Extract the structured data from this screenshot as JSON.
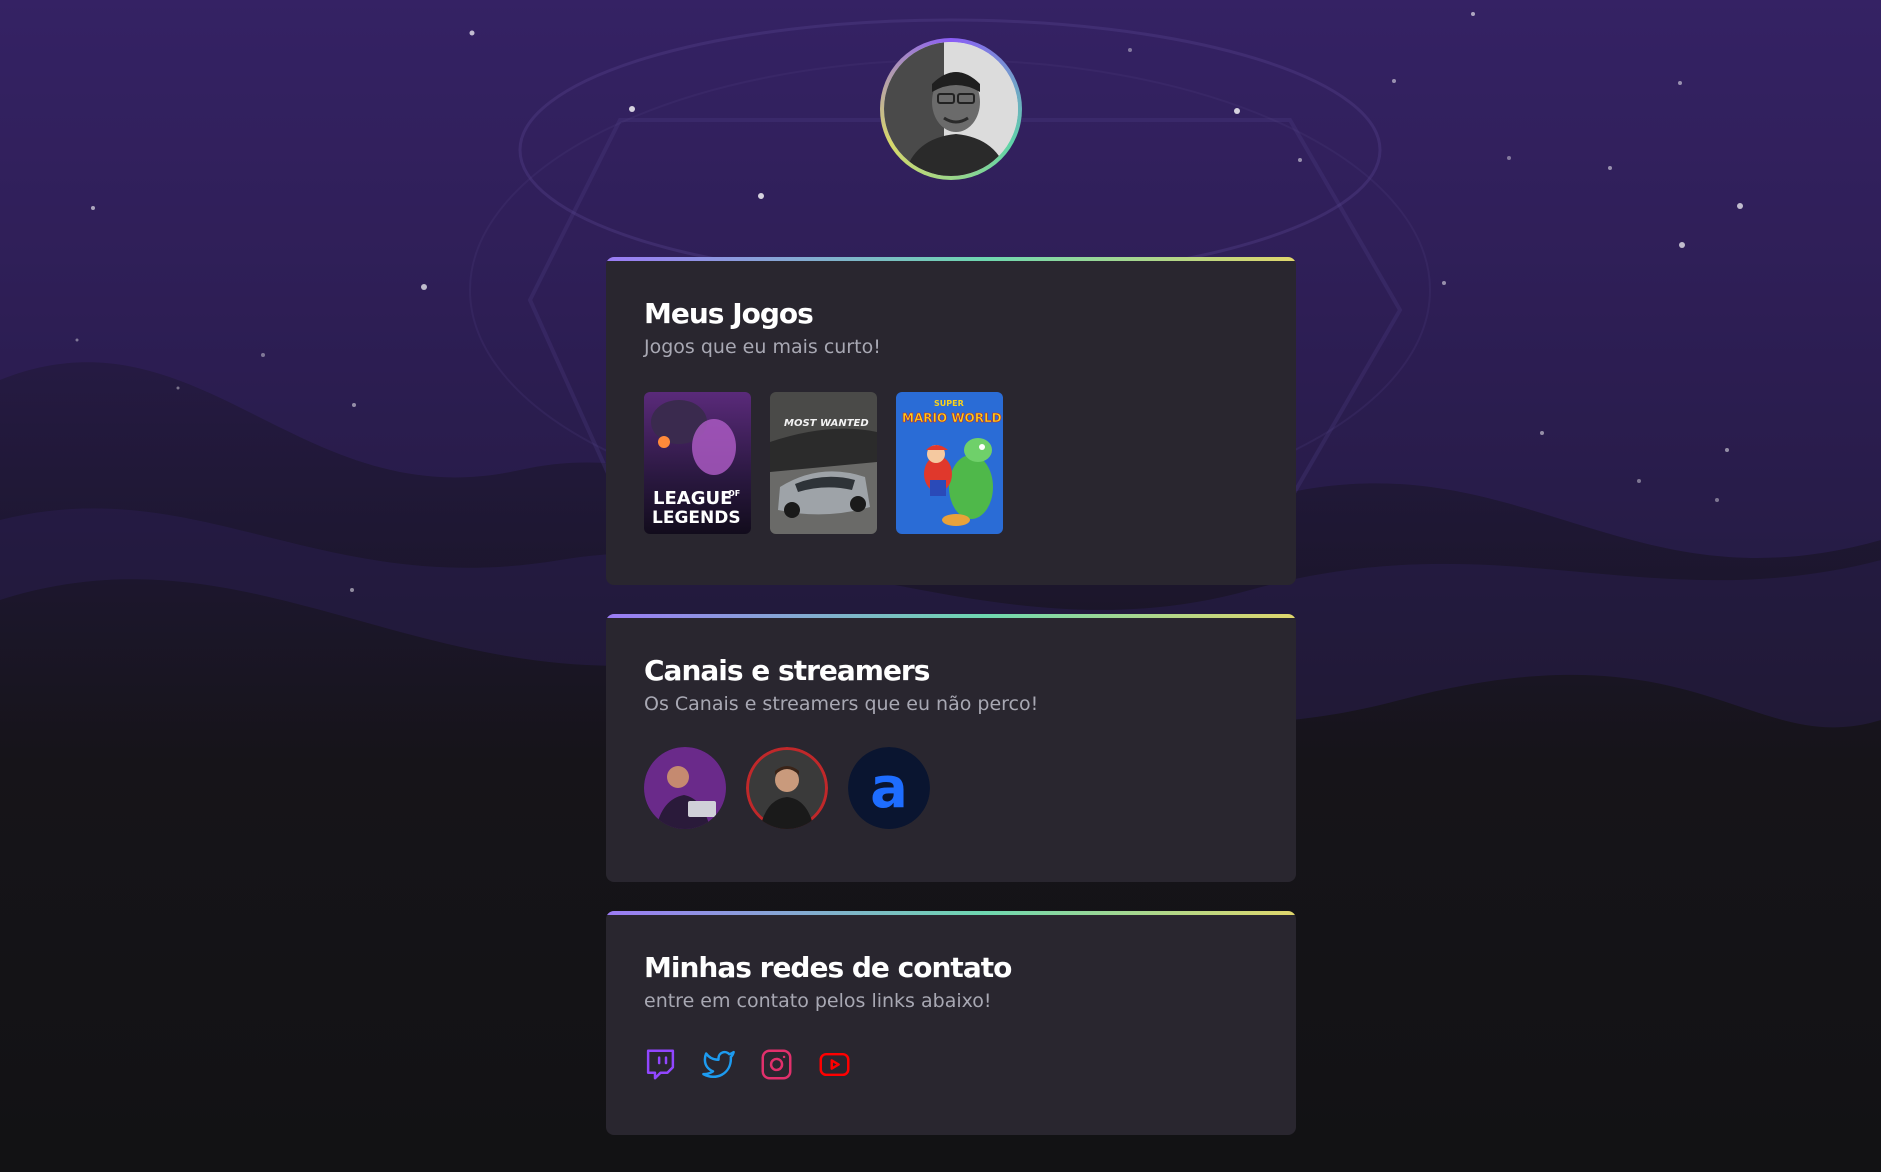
{
  "colors": {
    "accent_gradient": [
      "#9b7bf5",
      "#6ed7b0",
      "#e0d66c"
    ],
    "card_bg": "#29262f",
    "text_muted": "#a8a8b3",
    "twitch": "#9146ff",
    "twitter": "#1d9bf0",
    "instagram": "#e1306c",
    "youtube": "#ff0000"
  },
  "profile": {
    "avatar_icon": "user-avatar"
  },
  "games_section": {
    "title": "Meus Jogos",
    "subtitle": "Jogos que eu mais curto!",
    "games": [
      {
        "logo_line1": "LEAGUE",
        "logo_line2": "OF",
        "logo_line3": "LEGENDS"
      },
      {
        "logo_line1": "MOST WANTED"
      },
      {
        "logo_line1": "SUPER",
        "logo_line2": "MARIO WORLD"
      }
    ]
  },
  "channels_section": {
    "title": "Canais e streamers",
    "subtitle": "Os Canais e streamers que eu não perco!",
    "channels": [
      {
        "icon": "streamer-avatar"
      },
      {
        "icon": "streamer-avatar"
      },
      {
        "icon": "channel-logo",
        "letter": "a"
      }
    ]
  },
  "socials_section": {
    "title": "Minhas redes de contato",
    "subtitle": "entre em contato pelos links abaixo!",
    "links": [
      {
        "icon": "twitch-icon"
      },
      {
        "icon": "twitter-icon"
      },
      {
        "icon": "instagram-icon"
      },
      {
        "icon": "youtube-icon"
      }
    ]
  }
}
